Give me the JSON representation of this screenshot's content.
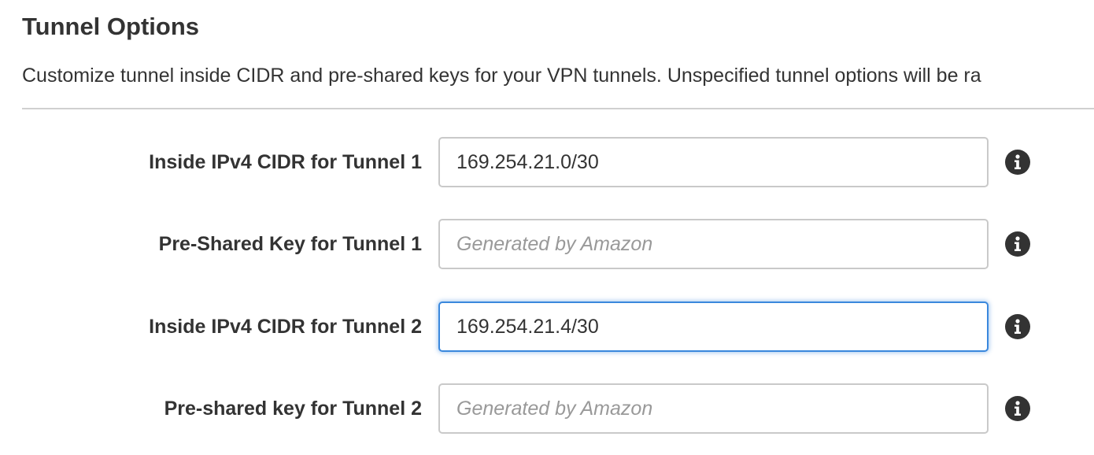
{
  "section": {
    "title": "Tunnel Options",
    "description": "Customize tunnel inside CIDR and pre-shared keys for your VPN tunnels. Unspecified tunnel options will be ra"
  },
  "fields": [
    {
      "label": "Inside IPv4 CIDR for Tunnel 1",
      "value": "169.254.21.0/30",
      "placeholder": "",
      "info_icon": "info-circle-icon"
    },
    {
      "label": "Pre-Shared Key for Tunnel 1",
      "value": "",
      "placeholder": "Generated by Amazon",
      "info_icon": "info-circle-icon"
    },
    {
      "label": "Inside IPv4 CIDR for Tunnel 2",
      "value": "169.254.21.4/30",
      "placeholder": "",
      "focused": true,
      "info_icon": "info-circle-icon"
    },
    {
      "label": "Pre-shared key for Tunnel 2",
      "value": "",
      "placeholder": "Generated by Amazon",
      "info_icon": "info-circle-icon"
    }
  ],
  "colors": {
    "focus_border": "#3a88dd",
    "info_icon": "#333333",
    "placeholder": "#999999"
  }
}
